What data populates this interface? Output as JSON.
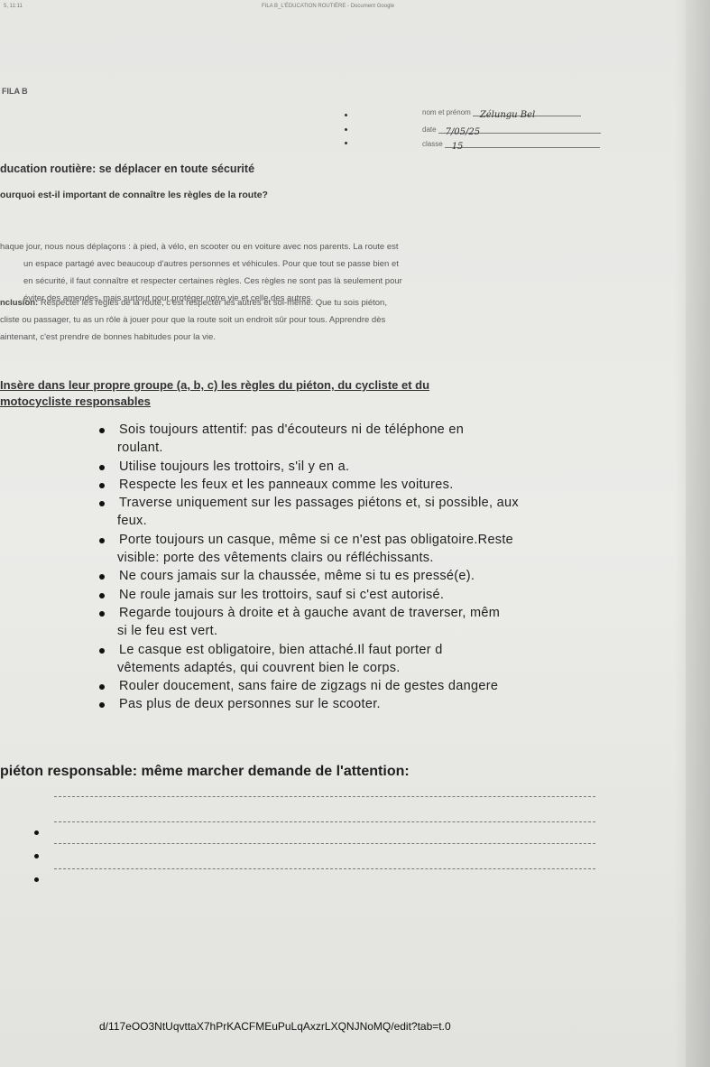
{
  "header": {
    "left": "5, 11:11",
    "center": "FILA B_L'ÉDUCATION ROUTIÈRE - Document Google"
  },
  "fila_label": "FILA B",
  "fields": {
    "name_label": "nom et prénom",
    "name_value": "Zélungu Bel",
    "date_label": "date",
    "date_value": "7/05/25",
    "class_label": "classe",
    "class_value": "15"
  },
  "title": "ducation routière: se déplacer en toute sécurité",
  "question": "ourquoi est-il important de connaître les règles de la route?",
  "paragraph1": {
    "l1": "haque jour, nous nous déplaçons : à pied, à vélo, en scooter ou en voiture avec nos parents. La route est",
    "l2": "un espace partagé avec beaucoup d'autres personnes et véhicules. Pour que tout se passe bien et",
    "l3": "en sécurité, il faut connaître et respecter certaines règles. Ces règles ne sont pas là seulement pour",
    "l4": "éviter des amendes, mais surtout pour protéger notre vie et celle des autres."
  },
  "paragraph2": {
    "bold": "nclusion:",
    "l1": " Respecter les règles de la route, c'est respecter les autres et soi-même. Que tu sois piéton,",
    "l2": "cliste ou passager, tu as un rôle à jouer pour que la route soit un endroit sûr pour tous. Apprendre dès",
    "l3": "aintenant, c'est prendre de bonnes habitudes pour la vie."
  },
  "section": {
    "l1": "Insère dans leur propre groupe  (a, b, c) les règles du piéton, du cycliste et du",
    "l2": "motocycliste responsables"
  },
  "rules": [
    {
      "a": "Sois toujours attentif: pas d'écouteurs ni de téléphone en",
      "b": "roulant."
    },
    {
      "a": "Utilise toujours les trottoirs, s'il y en a.",
      "b": ""
    },
    {
      "a": "Respecte les feux et les panneaux comme les voitures.",
      "b": ""
    },
    {
      "a": "Traverse uniquement sur les passages piétons et, si possible, aux",
      "b": "feux."
    },
    {
      "a": "Porte toujours un casque, même si ce n'est pas obligatoire.Reste",
      "b": "visible: porte des vêtements clairs ou réfléchissants."
    },
    {
      "a": "Ne cours jamais sur la chaussée, même si tu es pressé(e).",
      "b": ""
    },
    {
      "a": "Ne roule jamais sur les trottoirs, sauf si c'est autorisé.",
      "b": ""
    },
    {
      "a": "Regarde toujours à droite et à gauche avant de traverser, mêm",
      "b": "si le feu est vert."
    },
    {
      "a": "Le casque est obligatoire, bien attaché.Il faut porter d",
      "b": "vêtements adaptés, qui couvrent bien le corps."
    },
    {
      "a": "Rouler doucement, sans faire de zigzags ni de gestes dangere",
      "b": ""
    },
    {
      "a": "Pas plus de deux personnes sur le scooter.",
      "b": ""
    }
  ],
  "pedestrian_title": "piéton responsable: même marcher demande de l'attention:",
  "url": "d/117eOO3NtUqvttaX7hPrKACFMEuPuLqAxzrLXQNJNoMQ/edit?tab=t.0"
}
